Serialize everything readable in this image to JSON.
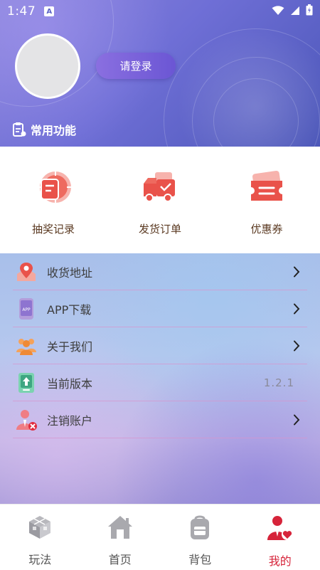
{
  "status_bar": {
    "time": "1:47",
    "notification_badge": "A"
  },
  "profile": {
    "login_label": "请登录"
  },
  "section": {
    "title": "常用功能"
  },
  "functions": [
    {
      "label": "抽奖记录",
      "icon": "lottery-record-icon"
    },
    {
      "label": "发货订单",
      "icon": "delivery-truck-icon"
    },
    {
      "label": "优惠券",
      "icon": "coupon-icon"
    }
  ],
  "menu": [
    {
      "label": "收货地址",
      "icon": "map-location-icon",
      "trailing": "chevron"
    },
    {
      "label": "APP下载",
      "icon": "app-download-icon",
      "app_badge": "APP",
      "trailing": "chevron"
    },
    {
      "label": "关于我们",
      "icon": "group-people-icon",
      "trailing": "chevron"
    },
    {
      "label": "当前版本",
      "icon": "version-upload-icon",
      "trailing": "value",
      "value": "1.2.1"
    },
    {
      "label": "注销账户",
      "icon": "delete-account-icon",
      "trailing": "chevron"
    }
  ],
  "tabs": [
    {
      "label": "玩法",
      "icon": "cube-icon",
      "active": false
    },
    {
      "label": "首页",
      "icon": "home-icon",
      "active": false
    },
    {
      "label": "背包",
      "icon": "backpack-icon",
      "active": false
    },
    {
      "label": "我的",
      "icon": "user-heart-icon",
      "active": true
    }
  ],
  "colors": {
    "accent": "#d6243a",
    "header_gradient": [
      "#8a84dc",
      "#4b56b8"
    ],
    "login_button": "#7a62da",
    "function_icon": "#e9524a",
    "label_text": "#5b3a22"
  }
}
